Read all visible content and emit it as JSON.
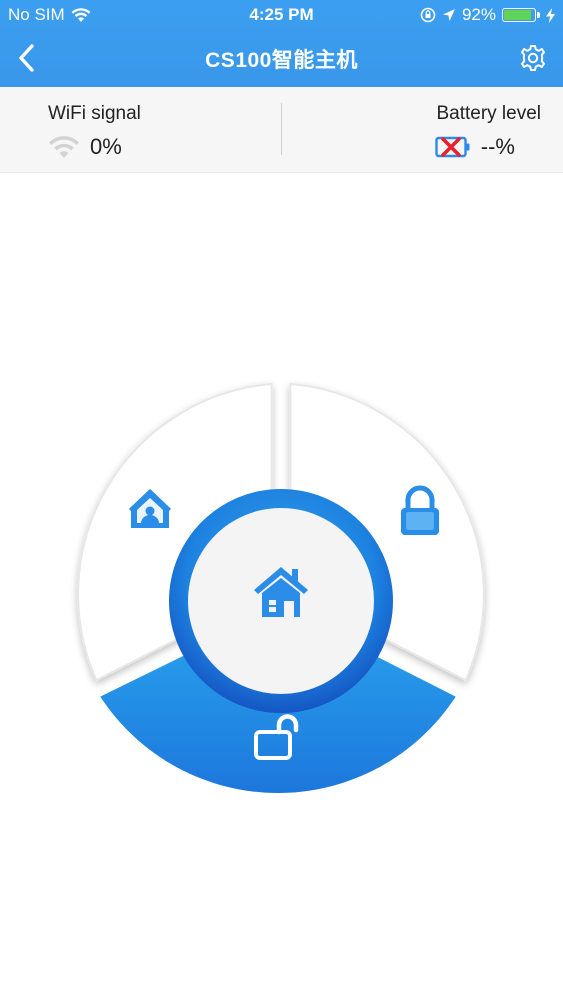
{
  "status_bar": {
    "carrier": "No SIM",
    "time": "4:25 PM",
    "battery_percent": "92%",
    "battery_fill_fraction": 0.92,
    "icons": [
      "wifi-icon",
      "orientation-lock-icon",
      "location-icon",
      "battery-icon",
      "charging-icon"
    ]
  },
  "nav": {
    "title": "CS100智能主机",
    "back_icon": "chevron-left-icon",
    "settings_icon": "gear-icon"
  },
  "info": {
    "wifi_label": "WiFi signal",
    "wifi_value": "0%",
    "battery_label": "Battery level",
    "battery_value": "--%"
  },
  "dial": {
    "segments": [
      {
        "name": "home-arm-segment",
        "icon": "home-person-icon"
      },
      {
        "name": "away-arm-segment",
        "icon": "lock-icon"
      },
      {
        "name": "disarm-segment",
        "icon": "unlock-icon",
        "selected": true
      }
    ],
    "center_icon": "home-icon"
  },
  "colors": {
    "header_blue": "#3a9bee",
    "accent_blue": "#1f8fe6",
    "ring_blue": "#1b6fd6",
    "battery_alert_red": "#e8212b",
    "battery_green": "#5fd35a"
  }
}
